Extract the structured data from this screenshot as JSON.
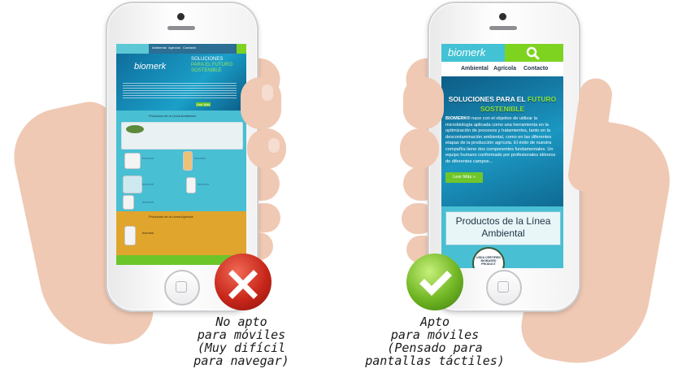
{
  "left_phone": {
    "site": {
      "nav_items": [
        "Ambiental",
        "Agrícola",
        "Contacto"
      ],
      "hero_title_1": "SOLUCIONES",
      "hero_title_2": "PARA EL FUTURO",
      "hero_title_3": "SOSTENIBLE",
      "logo": "biomerk",
      "section_1": "Productos de la Línea Ambiental",
      "section_2": "Productos de la Línea Agrícola",
      "read_more": "Leer Más"
    }
  },
  "right_phone": {
    "site": {
      "logo": "biomerk",
      "nav_items": [
        "Ambiental",
        "Agrícola",
        "Contacto"
      ],
      "hero_title_a": "SOLUCIONES PARA EL",
      "hero_title_accent": "FUTURO",
      "hero_title_b": "SOSTENIBLE",
      "hero_brand": "BIOMERK®",
      "hero_body": " nace con el objetivo de utilizar la microbiología aplicada como una herramienta en la optimización de procesos y tratamientos, tanto en la descontaminación ambiental, como en las diferentes etapas de la producción agrícola. El éxito de nuestra compañía tiene dos componentes fundamentales. Un equipo humano conformado por profesionales idóneos de diferentes campos...",
      "read_more": "Leer Más »",
      "products_title": "Productos de la Línea Ambiental",
      "badge": "USDA CERTIFIED BIOBASED PRODUCT"
    }
  },
  "captions": {
    "left": [
      "No apto",
      "para móviles",
      "(Muy difícil",
      "para navegar)"
    ],
    "right": [
      "Apto",
      "para móviles",
      "(Pensado para",
      "pantallas táctiles)"
    ]
  },
  "colors": {
    "brand_teal": "#42c2d4",
    "brand_green": "#7ed321",
    "x_red": "#c8271a",
    "check_green": "#6fb523"
  }
}
